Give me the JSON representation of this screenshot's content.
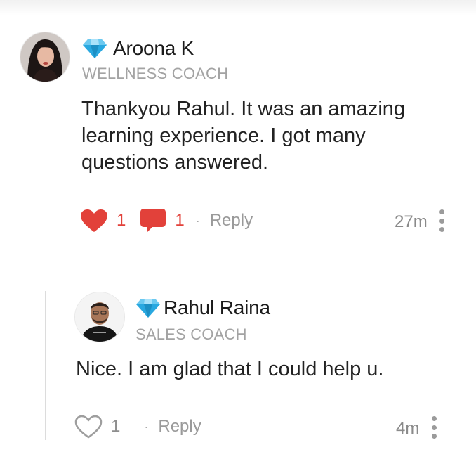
{
  "comments": [
    {
      "author": "Aroona K",
      "role": "WELLNESS COACH",
      "text_lines": [
        "Thankyou Rahul. It was an amazing",
        "learning experience. I got many",
        "questions answered."
      ],
      "likes": "1",
      "replies": "1",
      "reply_label": "Reply",
      "separator": "·",
      "time": "27m",
      "liked": true
    },
    {
      "author": "Rahul Raina",
      "role": "SALES COACH",
      "text_lines": [
        "Nice. I am glad that I could help u."
      ],
      "likes": "1",
      "reply_label": "Reply",
      "separator": "·",
      "time": "4m",
      "liked": false
    }
  ],
  "icons": {
    "badge": "diamond-icon",
    "like_active": "heart-filled-icon",
    "like_inactive": "heart-outline-icon",
    "comments": "speech-bubble-icon",
    "more": "more-vertical-icon"
  },
  "colors": {
    "accent_red": "#e2413a",
    "diamond": "#29a8e0",
    "role_text": "#a3a3a3"
  }
}
